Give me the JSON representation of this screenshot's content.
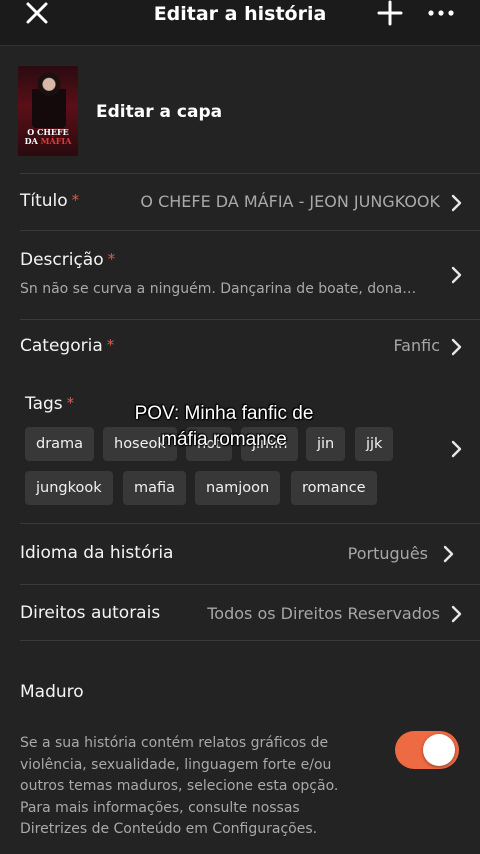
{
  "header": {
    "title": "Editar a história",
    "icons": {
      "close": "close-icon",
      "add": "plus-icon",
      "more": "more-icon"
    }
  },
  "cover": {
    "label": "Editar a capa",
    "image_text_line1": "O CHEFE",
    "image_text_line2a": "DA",
    "image_text_line2b": "MÁFIA"
  },
  "fields": {
    "title": {
      "label": "Título",
      "required": "*",
      "value": "O CHEFE DA MÁFIA - JEON JUNGKOOK"
    },
    "description": {
      "label": "Descrição",
      "required": "*",
      "value": "Sn não se curva a ninguém. Dançarina de boate, dona…"
    },
    "category": {
      "label": "Categoria",
      "required": "*",
      "value": "Fanfic"
    },
    "tags": {
      "label": "Tags",
      "required": "*",
      "items": [
        "drama",
        "hoseok",
        "hot",
        "jimin",
        "jin",
        "jjk",
        "jungkook",
        "mafia",
        "namjoon",
        "romance"
      ]
    },
    "language": {
      "label": "Idioma da história",
      "value": "Português"
    },
    "copyright": {
      "label": "Direitos autorais",
      "value": "Todos os Direitos Reservados"
    }
  },
  "mature": {
    "label": "Maduro",
    "description": "Se a sua história contém relatos gráficos de violência, sexualidade, linguagem forte e/ou outros temas maduros, selecione esta opção. Para mais informações, consulte nossas Diretrizes de Conteúdo em Configurações.",
    "enabled": true
  },
  "overlay": {
    "line1": "POV: Minha fanfic de",
    "line2": "máfia romance"
  },
  "colors": {
    "background": "#232323",
    "accent_toggle": "#ee6a42",
    "required": "#e8574a",
    "tag_bg": "#383838"
  }
}
